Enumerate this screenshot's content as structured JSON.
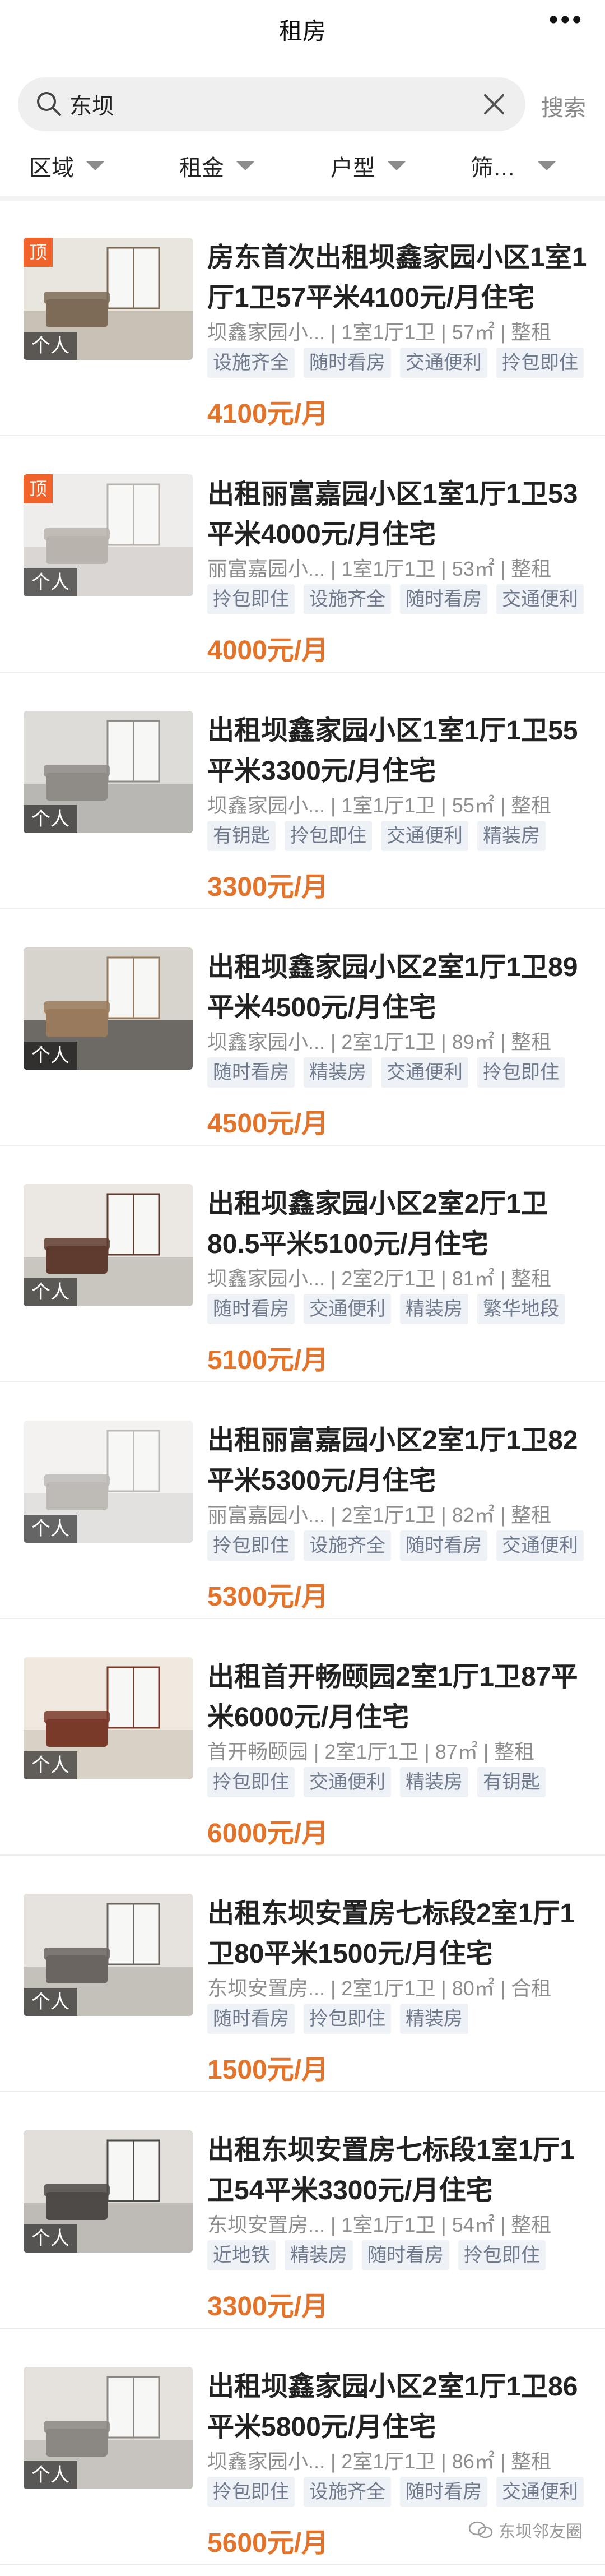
{
  "header": {
    "title": "租房",
    "more_label": "•••"
  },
  "search": {
    "value": "东坝",
    "placeholder": "",
    "button_label": "搜索"
  },
  "filters": [
    "区域",
    "租金",
    "户型",
    "筛…"
  ],
  "listings": [
    {
      "title": "房东首次出租坝鑫家园小区1室1厅1卫57平米4100元/月住宅",
      "meta": "坝鑫家园小... | 1室1厅1卫 | 57㎡ | 整租",
      "tags": [
        "设施齐全",
        "随时看房",
        "交通便利",
        "拎包即住"
      ],
      "price": "4100元/月",
      "top_badge": "顶",
      "owner_badge": "个人",
      "colors": [
        "#c8c2b6",
        "#7d6b58",
        "#e9e6df"
      ]
    },
    {
      "title": "出租丽富嘉园小区1室1厅1卫53平米4000元/月住宅",
      "meta": "丽富嘉园小... | 1室1厅1卫 | 53㎡ | 整租",
      "tags": [
        "拎包即住",
        "设施齐全",
        "随时看房",
        "交通便利"
      ],
      "price": "4000元/月",
      "top_badge": "顶",
      "owner_badge": "个人",
      "colors": [
        "#d9d6d3",
        "#b9b3ad",
        "#efedeb"
      ]
    },
    {
      "title": "出租坝鑫家园小区1室1厅1卫55平米3300元/月住宅",
      "meta": "坝鑫家园小... | 1室1厅1卫 | 55㎡ | 整租",
      "tags": [
        "有钥匙",
        "拎包即住",
        "交通便利",
        "精装房"
      ],
      "price": "3300元/月",
      "top_badge": "",
      "owner_badge": "个人",
      "colors": [
        "#b8b7b4",
        "#8f8c88",
        "#dedcd8"
      ]
    },
    {
      "title": "出租坝鑫家园小区2室1厅1卫89平米4500元/月住宅",
      "meta": "坝鑫家园小... | 2室1厅1卫 | 89㎡ | 整租",
      "tags": [
        "随时看房",
        "精装房",
        "交通便利",
        "拎包即住"
      ],
      "price": "4500元/月",
      "top_badge": "",
      "owner_badge": "个人",
      "colors": [
        "#6d6a66",
        "#9a7a5c",
        "#d7d3cd"
      ]
    },
    {
      "title": "出租坝鑫家园小区2室2厅1卫80.5平米5100元/月住宅",
      "meta": "坝鑫家园小... | 2室2厅1卫 | 81㎡ | 整租",
      "tags": [
        "随时看房",
        "交通便利",
        "精装房",
        "繁华地段"
      ],
      "price": "5100元/月",
      "top_badge": "",
      "owner_badge": "个人",
      "colors": [
        "#c9c5bf",
        "#5e3b2e",
        "#ebe8e3"
      ]
    },
    {
      "title": "出租丽富嘉园小区2室1厅1卫82平米5300元/月住宅",
      "meta": "丽富嘉园小... | 2室1厅1卫 | 82㎡ | 整租",
      "tags": [
        "拎包即住",
        "设施齐全",
        "随时看房",
        "交通便利"
      ],
      "price": "5300元/月",
      "top_badge": "",
      "owner_badge": "个人",
      "colors": [
        "#e2e1df",
        "#bdbab6",
        "#f3f2f0"
      ]
    },
    {
      "title": "出租首开畅颐园2室1厅1卫87平米6000元/月住宅",
      "meta": "首开畅颐园 | 2室1厅1卫 | 87㎡ | 整租",
      "tags": [
        "拎包即住",
        "交通便利",
        "精装房",
        "有钥匙"
      ],
      "price": "6000元/月",
      "top_badge": "",
      "owner_badge": "个人",
      "colors": [
        "#d8d1c6",
        "#7a3a2a",
        "#efe9df"
      ]
    },
    {
      "title": "出租东坝安置房七标段2室1厅1卫80平米1500元/月住宅",
      "meta": "东坝安置房... | 2室1厅1卫 | 80㎡ | 合租",
      "tags": [
        "随时看房",
        "拎包即住",
        "精装房"
      ],
      "price": "1500元/月",
      "top_badge": "",
      "owner_badge": "个人",
      "colors": [
        "#c4c0ba",
        "#6a6560",
        "#e6e3de"
      ]
    },
    {
      "title": "出租东坝安置房七标段1室1厅1卫54平米3300元/月住宅",
      "meta": "东坝安置房... | 1室1厅1卫 | 54㎡ | 整租",
      "tags": [
        "近地铁",
        "精装房",
        "随时看房",
        "拎包即住"
      ],
      "price": "3300元/月",
      "top_badge": "",
      "owner_badge": "个人",
      "colors": [
        "#bdbab5",
        "#4d4a47",
        "#e1ded9"
      ]
    },
    {
      "title": "出租坝鑫家园小区2室1厅1卫86平米5800元/月住宅",
      "meta": "坝鑫家园小... | 2室1厅1卫 | 86㎡ | 整租",
      "tags": [
        "拎包即住",
        "设施齐全",
        "随时看房",
        "交通便利"
      ],
      "price": "5600元/月",
      "top_badge": "",
      "owner_badge": "个人",
      "colors": [
        "#c7c4bf",
        "#8b8782",
        "#e5e2dd"
      ]
    }
  ],
  "watermark": {
    "text": "东坝邻友圈"
  }
}
